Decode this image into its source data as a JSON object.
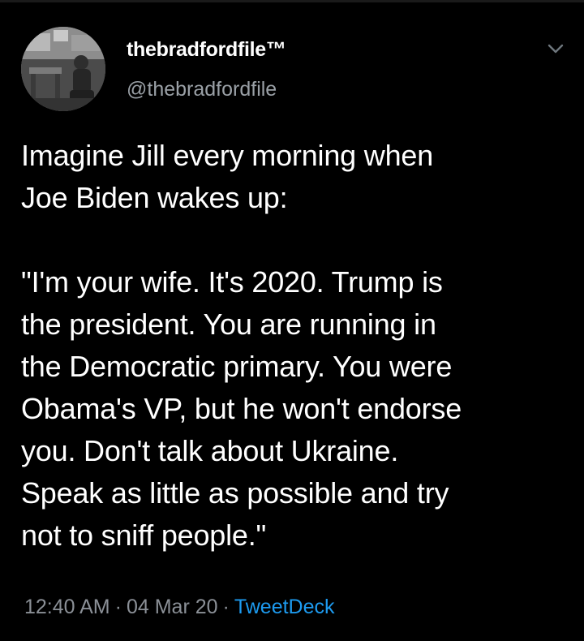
{
  "tweet": {
    "display_name": "thebradfordfile™",
    "handle": "@thebradfordfile",
    "paragraphs": [
      "Imagine Jill every morning when\nJoe Biden wakes up:",
      "\"I'm your wife. It's 2020. Trump is\nthe president. You are running in\nthe Democratic primary. You were\nObama's VP, but he won't endorse\nyou. Don't talk about Ukraine.\nSpeak as little as possible and try\nnot to sniff people.\""
    ],
    "time": "12:40 AM",
    "date": "04 Mar 20",
    "source": "TweetDeck",
    "separator": "·"
  },
  "colors": {
    "background": "#000000",
    "text": "#ffffff",
    "secondary_text": "#9aa0a6",
    "link": "#1d9bf0"
  },
  "icons": {
    "menu": "chevron-down-icon",
    "avatar": "profile-photo"
  }
}
